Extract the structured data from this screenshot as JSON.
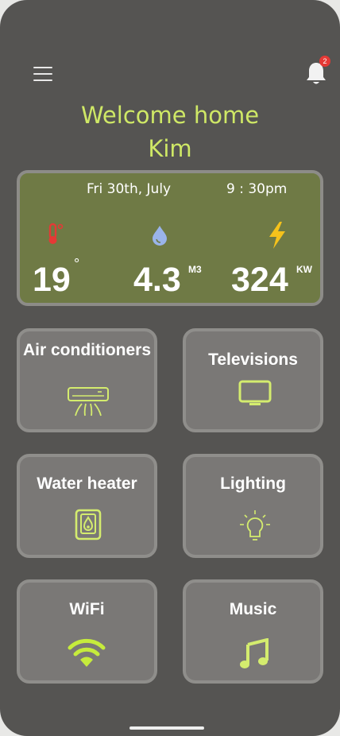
{
  "header": {
    "notification_count": "2",
    "menu_icon": "hamburger-menu-icon",
    "bell_icon": "bell-icon"
  },
  "welcome": {
    "line1": "Welcome home",
    "line2": "Kim"
  },
  "stats": {
    "date": "Fri 30th, July",
    "time": "9 : 30pm",
    "temperature": {
      "icon": "thermometer-icon",
      "value": "19",
      "unit": "°"
    },
    "water": {
      "icon": "water-drop-icon",
      "value": "4.3",
      "unit": "M3"
    },
    "power": {
      "icon": "lightning-icon",
      "value": "324",
      "unit": "KW"
    }
  },
  "devices": [
    {
      "label": "Air conditioners",
      "icon": "air-conditioner-icon"
    },
    {
      "label": "Televisions",
      "icon": "television-icon"
    },
    {
      "label": "Water heater",
      "icon": "water-heater-icon"
    },
    {
      "label": "Lighting",
      "icon": "light-bulb-icon"
    },
    {
      "label": "WiFi",
      "icon": "wifi-icon"
    },
    {
      "label": "Music",
      "icon": "music-note-icon"
    }
  ],
  "colors": {
    "background": "#555452",
    "accent": "#cfe866",
    "stats_panel": "#6f7a45",
    "card": "#7a7876",
    "badge": "#e53935"
  }
}
